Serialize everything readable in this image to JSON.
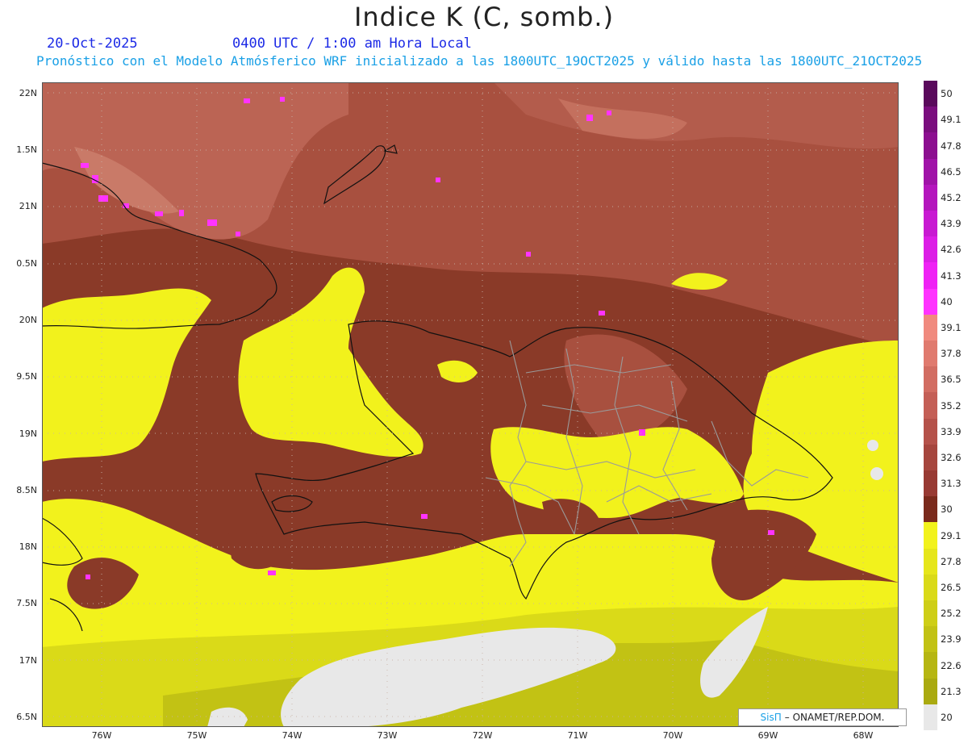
{
  "header": {
    "title": "Indice K (C, somb.)",
    "date": "20-Oct-2025",
    "time": "0400 UTC / 1:00 am Hora Local",
    "forecast": "Pronóstico con el Modelo Atmósferico WRF inicializado a las 1800UTC_19OCT2025 y válido hasta las  1800UTC_21OCT2025"
  },
  "axes": {
    "y_labels": [
      "22N",
      "1.5N",
      "21N",
      "0.5N",
      "20N",
      "9.5N",
      "19N",
      "8.5N",
      "18N",
      "7.5N",
      "17N",
      "6.5N"
    ],
    "x_labels": [
      "76W",
      "75W",
      "74W",
      "73W",
      "72W",
      "71W",
      "70W",
      "69W",
      "68W"
    ]
  },
  "colorbar": {
    "labels": [
      "50",
      "49.1",
      "47.8",
      "46.5",
      "45.2",
      "43.9",
      "42.6",
      "41.3",
      "40",
      "39.1",
      "37.8",
      "36.5",
      "35.2",
      "33.9",
      "32.6",
      "31.3",
      "30",
      "29.1",
      "27.8",
      "26.5",
      "25.2",
      "23.9",
      "22.6",
      "21.3",
      "20"
    ],
    "colors": [
      "#5a0a5c",
      "#7a0e7e",
      "#8c0f90",
      "#a013a8",
      "#b416bd",
      "#c81ad2",
      "#dc1ee6",
      "#ef22f5",
      "#ff33ff",
      "#f08a7e",
      "#e07a6e",
      "#d26d62",
      "#c45f56",
      "#b5524a",
      "#a6463e",
      "#983a33",
      "#7a2a1c",
      "#f2f21c",
      "#e6e61a",
      "#dada18",
      "#cece16",
      "#c2c214",
      "#b6b612",
      "#aaaa10",
      "#e8e8e8"
    ]
  },
  "credit": {
    "brand": "SisΠ",
    "text": "– ONAMET/REP.DOM."
  }
}
